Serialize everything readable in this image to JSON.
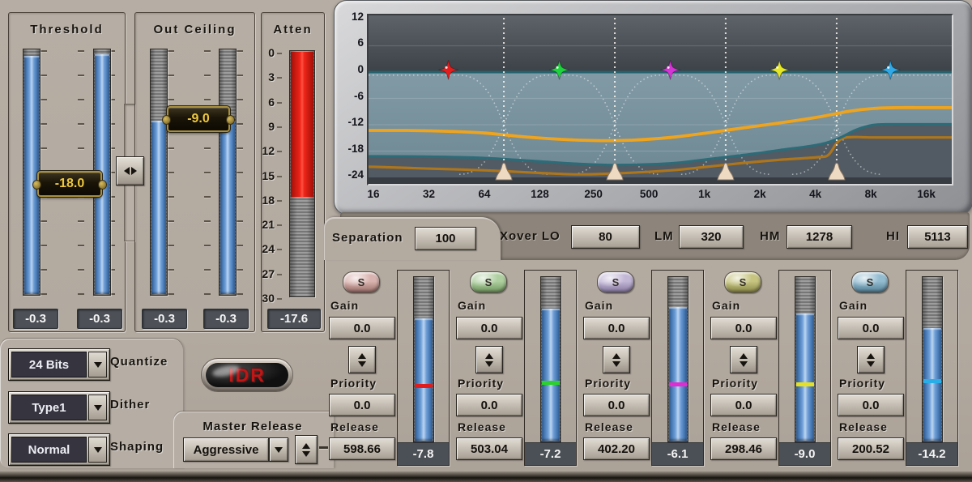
{
  "threshold_panel": {
    "title": "Threshold",
    "tag_value": "-18.0",
    "readouts": [
      "-0.3",
      "-0.3"
    ],
    "slider_fill_from_pct": [
      2.5,
      2
    ]
  },
  "out_ceiling_panel": {
    "title": "Out Ceiling",
    "tag_value": "-9.0",
    "readouts": [
      "-0.3",
      "-0.3"
    ],
    "slider_fill_from_pct": [
      29,
      29
    ]
  },
  "atten_panel": {
    "title": "Atten",
    "scale_labels": [
      "0",
      "3",
      "6",
      "9",
      "12",
      "15",
      "18",
      "21",
      "24",
      "27",
      "30"
    ],
    "readout": "-17.6",
    "fill_pct": 59
  },
  "quantize": {
    "value": "24 Bits",
    "label": "Quantize"
  },
  "dither": {
    "value": "Type1",
    "label": "Dither"
  },
  "shaping": {
    "value": "Normal",
    "label": "Shaping"
  },
  "idr_label": "IDR",
  "master_release": {
    "label": "Master Release",
    "value": "Aggressive"
  },
  "separation": {
    "label": "Separation",
    "value": "100"
  },
  "xover": {
    "lo_label": "Xover LO",
    "lo": "80",
    "lm_label": "LM",
    "lm": "320",
    "hm_label": "HM",
    "hm": "1278",
    "hi_label": "HI",
    "hi": "5113"
  },
  "colors": {
    "meter_blue": "#5b8cc8",
    "atten_red": "#e02418",
    "tag_text": "#eec83e"
  },
  "bands": [
    {
      "solo_label": "S",
      "solo_color": "#d9b3af",
      "solo_color_dark": "#9a6e68",
      "gain_label": "Gain",
      "gain": "0.0",
      "priority_label": "Priority",
      "priority": "0.0",
      "release_label": "Release",
      "release": "598.66",
      "meter_readout": "-7.8",
      "mark_color": "#e01c1c",
      "meter_fill_from_pct": 25,
      "meter_mark_pct": 65
    },
    {
      "solo_label": "S",
      "solo_color": "#aecf9f",
      "solo_color_dark": "#6f965e",
      "gain_label": "Gain",
      "gain": "0.0",
      "priority_label": "Priority",
      "priority": "0.0",
      "release_label": "Release",
      "release": "503.04",
      "meter_readout": "-7.2",
      "mark_color": "#2bd22b",
      "meter_fill_from_pct": 19,
      "meter_mark_pct": 63
    },
    {
      "solo_label": "S",
      "solo_color": "#c3b7d6",
      "solo_color_dark": "#84769e",
      "gain_label": "Gain",
      "gain": "0.0",
      "priority_label": "Priority",
      "priority": "0.0",
      "release_label": "Release",
      "release": "402.20",
      "meter_readout": "-6.1",
      "mark_color": "#e02cd0",
      "meter_fill_from_pct": 18,
      "meter_mark_pct": 64
    },
    {
      "solo_label": "S",
      "solo_color": "#c6c47f",
      "solo_color_dark": "#8a8848",
      "gain_label": "Gain",
      "gain": "0.0",
      "priority_label": "Priority",
      "priority": "0.0",
      "release_label": "Release",
      "release": "298.46",
      "meter_readout": "-9.0",
      "mark_color": "#e6e020",
      "meter_fill_from_pct": 22,
      "meter_mark_pct": 64
    },
    {
      "solo_label": "S",
      "solo_color": "#93bcd0",
      "solo_color_dark": "#527e94",
      "gain_label": "Gain",
      "gain": "0.0",
      "priority_label": "Priority",
      "priority": "0.0",
      "release_label": "Release",
      "release": "200.52",
      "meter_readout": "-14.2",
      "mark_color": "#2aaee8",
      "meter_fill_from_pct": 31,
      "meter_mark_pct": 62
    }
  ],
  "chart_data": {
    "type": "line",
    "x_scale": "log",
    "xlim": [
      15,
      21000
    ],
    "ylim": [
      -24,
      12
    ],
    "grid_dbs": [
      6,
      -6,
      -12,
      -18
    ],
    "zero_line_db": 0,
    "x_ticks": [
      {
        "f": 16,
        "label": "16"
      },
      {
        "f": 32,
        "label": "32"
      },
      {
        "f": 64,
        "label": "64"
      },
      {
        "f": 128,
        "label": "128"
      },
      {
        "f": 250,
        "label": "250"
      },
      {
        "f": 500,
        "label": "500"
      },
      {
        "f": 1000,
        "label": "1k"
      },
      {
        "f": 2000,
        "label": "2k"
      },
      {
        "f": 4000,
        "label": "4k"
      },
      {
        "f": 8000,
        "label": "8k"
      },
      {
        "f": 16000,
        "label": "16k"
      }
    ],
    "y_ticks": [
      {
        "db": 12,
        "label": "12"
      },
      {
        "db": 6,
        "label": "6"
      },
      {
        "db": 0,
        "label": "0"
      },
      {
        "db": -6,
        "label": "-6"
      },
      {
        "db": -12,
        "label": "-12"
      },
      {
        "db": -18,
        "label": "-18"
      },
      {
        "db": -24,
        "label": "-24"
      }
    ],
    "crossover_freqs": [
      80,
      320,
      1278,
      5113
    ],
    "band_markers": [
      {
        "band": 1,
        "freq": 40,
        "db": 0.5,
        "color": "#e41c1c"
      },
      {
        "band": 2,
        "freq": 160,
        "db": 0.5,
        "color": "#1ed43c"
      },
      {
        "band": 3,
        "freq": 640,
        "db": 0.5,
        "color": "#d633d6"
      },
      {
        "band": 4,
        "freq": 2500,
        "db": 0.5,
        "color": "#e6e822"
      },
      {
        "band": 5,
        "freq": 10000,
        "db": 0.5,
        "color": "#2fa9e8"
      }
    ],
    "series": [
      {
        "name": "upper",
        "color": "#efa41e",
        "width": 3.8,
        "points": [
          [
            16,
            -13.3
          ],
          [
            24,
            -13.3
          ],
          [
            40,
            -13.5
          ],
          [
            64,
            -13.9
          ],
          [
            100,
            -14.7
          ],
          [
            160,
            -15.3
          ],
          [
            250,
            -15.6
          ],
          [
            400,
            -15.5
          ],
          [
            640,
            -14.9
          ],
          [
            1000,
            -13.9
          ],
          [
            1600,
            -12.7
          ],
          [
            2500,
            -11.6
          ],
          [
            4000,
            -10.3
          ],
          [
            6000,
            -8.9
          ],
          [
            8000,
            -8.3
          ],
          [
            11000,
            -8.1
          ],
          [
            16000,
            -8.1
          ],
          [
            20000,
            -8.1
          ]
        ]
      },
      {
        "name": "mid",
        "color": "#2d6b77",
        "width": 3.2,
        "fill_below": "#525a63",
        "points": [
          [
            16,
            -19.2
          ],
          [
            32,
            -19.3
          ],
          [
            64,
            -19.6
          ],
          [
            128,
            -20.4
          ],
          [
            200,
            -20.9
          ],
          [
            320,
            -21.2
          ],
          [
            640,
            -20.8
          ],
          [
            1000,
            -19.9
          ],
          [
            1600,
            -18.9
          ],
          [
            2500,
            -17.8
          ],
          [
            4000,
            -16.6
          ],
          [
            5113,
            -15.3
          ],
          [
            6500,
            -13.2
          ],
          [
            8000,
            -12.1
          ],
          [
            10000,
            -11.9
          ],
          [
            16000,
            -11.9
          ],
          [
            20000,
            -11.9
          ]
        ]
      },
      {
        "name": "lower",
        "color": "#ad751c",
        "width": 3.2,
        "points": [
          [
            16,
            -21.6
          ],
          [
            32,
            -22.0
          ],
          [
            64,
            -22.4
          ],
          [
            128,
            -23.0
          ],
          [
            200,
            -23.3
          ],
          [
            320,
            -23.1
          ],
          [
            640,
            -22.4
          ],
          [
            1000,
            -21.6
          ],
          [
            1600,
            -20.7
          ],
          [
            2500,
            -20.0
          ],
          [
            4000,
            -19.4
          ],
          [
            4600,
            -18.9
          ],
          [
            5113,
            -16.2
          ],
          [
            5600,
            -15.0
          ],
          [
            6500,
            -14.8
          ],
          [
            8000,
            -14.9
          ],
          [
            16000,
            -14.9
          ],
          [
            20000,
            -14.9
          ]
        ]
      }
    ]
  }
}
